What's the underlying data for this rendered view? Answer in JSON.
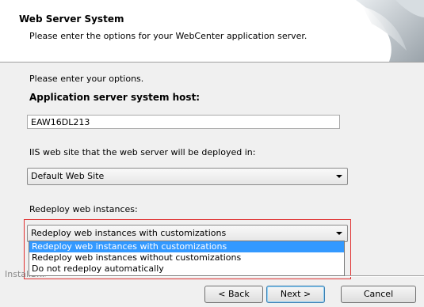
{
  "header": {
    "title": "Web Server System",
    "subtitle": "Please enter the options for your WebCenter application server."
  },
  "body": {
    "intro": "Please enter your options.",
    "host_label": "Application server system host:",
    "host_value": "EAW16DL213",
    "iis_label": "IIS web site that the web server will be deployed in:",
    "iis_selected": "Default Web Site",
    "redeploy_label": "Redeploy web instances:",
    "redeploy_selected": "Redeploy web instances with customizations",
    "redeploy_options": [
      "Redeploy web instances with customizations",
      "Redeploy web instances without customizations",
      "Do not redeploy automatically"
    ],
    "highlight_color": "#e03030",
    "selection_color": "#3399ff"
  },
  "footer": {
    "brand": "InstallShield",
    "back_label": "< Back",
    "next_label": "Next >",
    "cancel_label": "Cancel"
  }
}
